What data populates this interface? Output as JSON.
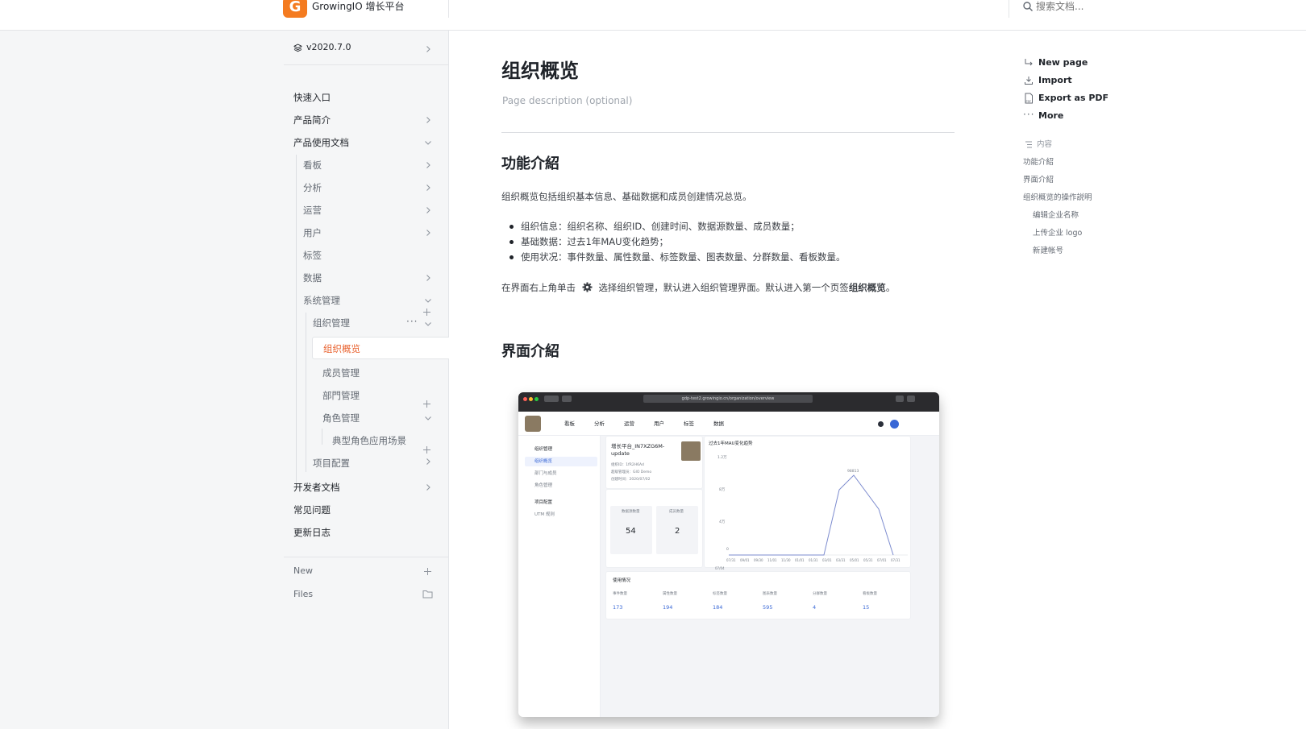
{
  "header": {
    "logo_letter": "G",
    "brand": "GrowingIO 增长平台",
    "search_placeholder": "搜索文档..."
  },
  "sidebar": {
    "version": "v2020.7.0",
    "items": [
      {
        "label": "快速入口"
      },
      {
        "label": "产品简介"
      },
      {
        "label": "产品使用文档"
      },
      {
        "label": "看板"
      },
      {
        "label": "分析"
      },
      {
        "label": "运营"
      },
      {
        "label": "用户"
      },
      {
        "label": "标签"
      },
      {
        "label": "数据"
      },
      {
        "label": "系统管理"
      },
      {
        "label": "组织管理"
      },
      {
        "label": "组织概览"
      },
      {
        "label": "成员管理"
      },
      {
        "label": "部門管理"
      },
      {
        "label": "角色管理"
      },
      {
        "label": "典型角色应用场景"
      },
      {
        "label": "项目配置"
      },
      {
        "label": "开发者文档"
      },
      {
        "label": "常见问题"
      },
      {
        "label": "更新日志"
      }
    ],
    "new_label": "New",
    "files_label": "Files"
  },
  "page": {
    "title": "组织概览",
    "description": "Page description (optional)",
    "section1_title": "功能介紹",
    "intro": "组织概览包括组织基本信息、基础数据和成员创建情况总览。",
    "bullets": [
      "组织信息：组织名称、组织ID、创建时间、数据源数量、成员数量；",
      "基础数据：过去1年MAU变化趋势；",
      "使用状况：事件数量、属性数量、标签数量、图表数量、分群数量、看板数量。"
    ],
    "instruction_pre": "在界面右上角单击",
    "instruction_mid": "选择组织管理，默认进入组织管理界面。默认进入第一个页签",
    "instruction_bold": "组织概览",
    "instruction_end": "。",
    "section2_title": "界面介紹"
  },
  "screenshot": {
    "url": "gdp-test2.growingio.cn/organization/overview",
    "nav": [
      "看板",
      "分析",
      "运营",
      "用户",
      "标签",
      "数据"
    ],
    "side": [
      "组织管理",
      "组织概览",
      "部门与成员",
      "角色管理",
      "项目配置",
      "UTM 规则"
    ],
    "org_name": "增长平台_IN7XZG6M-update",
    "org_meta": [
      "组织ID：1fR2H6Ad",
      "超级管理员：GIO Demo",
      "创建时间：2020/07/02"
    ],
    "stat1_label": "数据源数量",
    "stat1_value": "54",
    "stat2_label": "成员数量",
    "stat2_value": "2",
    "chart_title": "过去1年MAU变化趋势",
    "chart_peak": "98813",
    "y_ticks": [
      "1.2万",
      "8万",
      "4万",
      "0"
    ],
    "x_ticks": [
      "07/04",
      "07/31",
      "09/01",
      "09/30",
      "11/01",
      "11/30",
      "01/01",
      "01/31",
      "03/01",
      "03/31",
      "05/01",
      "05/31",
      "07/01",
      "07/31"
    ],
    "usage_title": "使用情况",
    "usage": [
      {
        "label": "事件数量",
        "value": "173"
      },
      {
        "label": "属性数量",
        "value": "194"
      },
      {
        "label": "标签数量",
        "value": "184"
      },
      {
        "label": "图表数量",
        "value": "595"
      },
      {
        "label": "分群数量",
        "value": "4"
      },
      {
        "label": "看板数量",
        "value": "15"
      }
    ]
  },
  "actions": {
    "new_page": "New page",
    "import": "Import",
    "export_pdf": "Export as PDF",
    "more": "More"
  },
  "toc": {
    "title": "内容",
    "items": [
      "功能介紹",
      "界面介紹",
      "组织概览的操作説明",
      "编辑企业名称",
      "上传企业 logo",
      "新建帐号"
    ]
  },
  "colors": {
    "accent": "#e8602c",
    "brand": "#f47b20"
  }
}
